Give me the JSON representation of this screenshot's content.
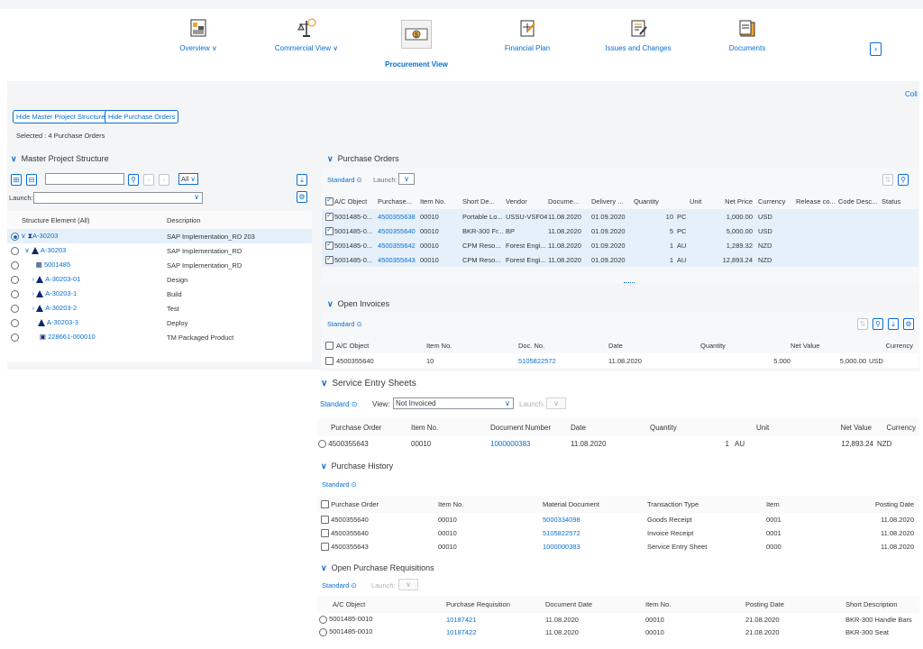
{
  "nav": {
    "items": [
      {
        "label": "Overview ∨"
      },
      {
        "label": "Commercial View ∨"
      },
      {
        "label": "Procurement View"
      },
      {
        "label": "Financial Plan"
      },
      {
        "label": "Issues and Changes"
      },
      {
        "label": "Documents"
      }
    ],
    "next": "›",
    "collapse": "Coll"
  },
  "toolbar": {
    "hide_mps": "Hide Master Project Structure",
    "hide_po": "Hide Purchase Orders",
    "selected": "Selected : 4  Purchase Orders"
  },
  "mps": {
    "title": "Master Project Structure",
    "filter": "All",
    "launch": "Launch:",
    "col1": "Structure Element (All)",
    "col2": "Description",
    "rows": [
      {
        "el": "A-30203",
        "desc": "SAP Implementation_RD 203"
      },
      {
        "el": "A-30203",
        "desc": "SAP Implementation_RD"
      },
      {
        "el": "5001485",
        "desc": "SAP Implementation_RD"
      },
      {
        "el": "A-30203-01",
        "desc": "Design"
      },
      {
        "el": "A-30203-1",
        "desc": "Build"
      },
      {
        "el": "A-30203-2",
        "desc": "Test"
      },
      {
        "el": "A-30203-3",
        "desc": "Deploy"
      },
      {
        "el": "228661-000010",
        "desc": "TM Packaged Product"
      }
    ]
  },
  "po": {
    "title": "Purchase Orders",
    "variant": "Standard",
    "launch": "Launch:",
    "cols": [
      "A/C Object",
      "Purchase...",
      "Item No.",
      "Short De...",
      "Vendor",
      "Docume...",
      "Delivery ...",
      "Quantity",
      "Unit",
      "Net Price",
      "Currency",
      "Release co...",
      "Code Desc...",
      "Status"
    ],
    "rows": [
      [
        "5001485-0...",
        "4500355638",
        "00010",
        "Portable Lo...",
        "USSU-VSF04",
        "11.08.2020",
        "01.09.2020",
        "10",
        "PC",
        "1,000.00",
        "USD"
      ],
      [
        "5001485-0...",
        "4500355640",
        "00010",
        "BKR-300 Fr...",
        "BP",
        "11.08.2020",
        "01.09.2020",
        "5",
        "PC",
        "5,000.00",
        "USD"
      ],
      [
        "5001485-0...",
        "4500355642",
        "00010",
        "CPM Reso...",
        "Forest Engi...",
        "11.08.2020",
        "01.09.2020",
        "1",
        "AU",
        "1,289.32",
        "NZD"
      ],
      [
        "5001485-0...",
        "4500355643",
        "00010",
        "CPM Reso...",
        "Forest Engi...",
        "11.08.2020",
        "01.09.2020",
        "1",
        "AU",
        "12,893.24",
        "NZD"
      ]
    ]
  },
  "oi": {
    "title": "Open Invoices",
    "variant": "Standard",
    "cols": [
      "A/C Object",
      "Item No.",
      "Doc. No.",
      "Date",
      "Quantity",
      "Net Value",
      "Currency"
    ],
    "rows": [
      [
        "4500355640",
        "10",
        "5105822572",
        "11.08.2020",
        "5.000",
        "5,000.00",
        "USD"
      ]
    ]
  },
  "ses": {
    "title": "Service Entry Sheets",
    "variant": "Standard",
    "view_label": "View:",
    "view_value": "Not Invoiced",
    "launch": "Launch:",
    "cols": [
      "Purchase Order",
      "Item No.",
      "Document Number",
      "Date",
      "Quantity",
      "Unit",
      "Net Value",
      "Currency"
    ],
    "rows": [
      [
        "4500355643",
        "00010",
        "1000000383",
        "11.08.2020",
        "1",
        "AU",
        "12,893.24",
        "NZD"
      ]
    ]
  },
  "ph": {
    "title": "Purchase History",
    "variant": "Standard",
    "cols": [
      "Purchase Order",
      "Item No.",
      "Material Document",
      "Transaction Type",
      "Item",
      "Posting Date"
    ],
    "rows": [
      [
        "4500355640",
        "00010",
        "5000334098",
        "Goods Receipt",
        "0001",
        "11.08.2020"
      ],
      [
        "4500355640",
        "00010",
        "5105822572",
        "Invoice Receipt",
        "0001",
        "11.08.2020"
      ],
      [
        "4500355643",
        "00010",
        "1000000383",
        "Service Entry Sheet",
        "0000",
        "11.08.2020"
      ]
    ]
  },
  "opr": {
    "title": "Open Purchase Requisitions",
    "variant": "Standard",
    "launch": "Launch:",
    "cols": [
      "A/C Object",
      "Purchase Requisition",
      "Document Date",
      "Item No.",
      "Posting Date",
      "Short Description"
    ],
    "rows": [
      [
        "5001485-0010",
        "10187421",
        "11.08.2020",
        "00010",
        "21.08.2020",
        "BKR-300 Handle Bars"
      ],
      [
        "5001485-0010",
        "10187422",
        "11.08.2020",
        "00010",
        "21.08.2020",
        "BKR-300 Seat"
      ]
    ]
  },
  "colors": {
    "accent": "#0a6ed1",
    "selected_row": "#e5f0fa",
    "grey_bg": "#f4f5f6"
  }
}
